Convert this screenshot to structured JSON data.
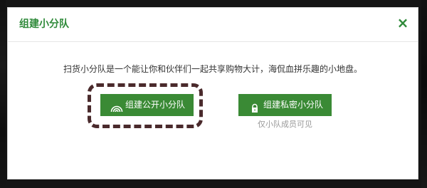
{
  "dialog": {
    "title": "组建小分队",
    "close_glyph": "×"
  },
  "content": {
    "description": "扫货小分队是一个能让你和伙伴们一起共享购物大计，海侃血拼乐趣的小地盘。",
    "public_button": {
      "label": "组建公开小分队",
      "icon": "signal-arcs-icon"
    },
    "private_button": {
      "label": "组建私密小分队",
      "icon": "lock-icon"
    },
    "private_note": "仅小队成员可见"
  },
  "colors": {
    "accent": "#3a8a35",
    "title": "#2f8a3a",
    "highlight_dash": "#4a2a2c"
  }
}
